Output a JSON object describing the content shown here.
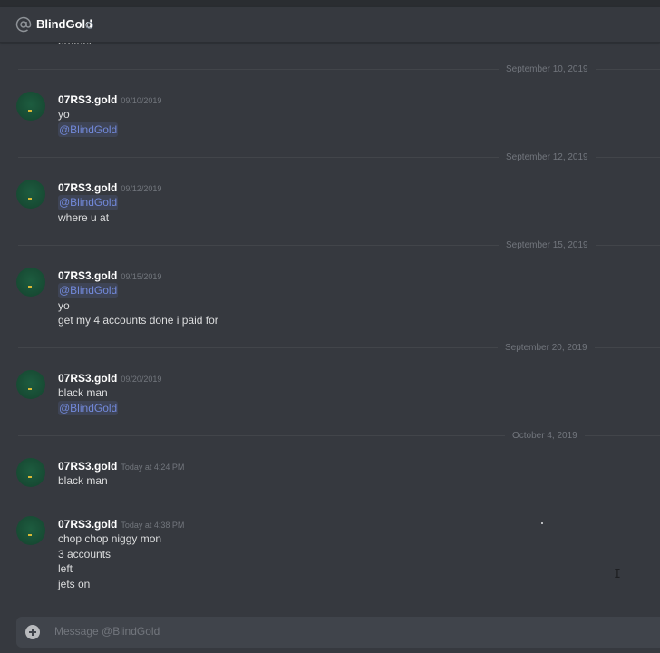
{
  "header": {
    "icon": "at-sign-icon",
    "username": "BlindGold",
    "status": "offline"
  },
  "partial_previous_message": "brother",
  "dividers": [
    "September 10, 2019",
    "September 12, 2019",
    "September 15, 2019",
    "September 20, 2019",
    "October 4, 2019"
  ],
  "messages": [
    {
      "author": "07RS3.gold",
      "timestamp": "09/10/2019",
      "lines": [
        "yo",
        "@BlindGold"
      ]
    },
    {
      "author": "07RS3.gold",
      "timestamp": "09/12/2019",
      "lines": [
        "@BlindGold",
        "where u at"
      ]
    },
    {
      "author": "07RS3.gold",
      "timestamp": "09/15/2019",
      "lines": [
        "@BlindGold",
        "yo",
        "get my 4 accounts done i paid for"
      ]
    },
    {
      "author": "07RS3.gold",
      "timestamp": "09/20/2019",
      "lines": [
        "black man",
        "@BlindGold"
      ]
    },
    {
      "author": "07RS3.gold",
      "timestamp": "Today at 4:24 PM",
      "lines": [
        "black man"
      ]
    },
    {
      "author": "07RS3.gold",
      "timestamp": "Today at 4:38 PM",
      "lines": [
        "chop chop niggy mon",
        "3 accounts",
        "left",
        "jets on"
      ]
    }
  ],
  "composer": {
    "placeholder": "Message @BlindGold",
    "attach_icon": "plus-circle-icon"
  },
  "colors": {
    "background": "#36393f",
    "mention": "#7289da",
    "avatar": "#1d5c3f"
  }
}
